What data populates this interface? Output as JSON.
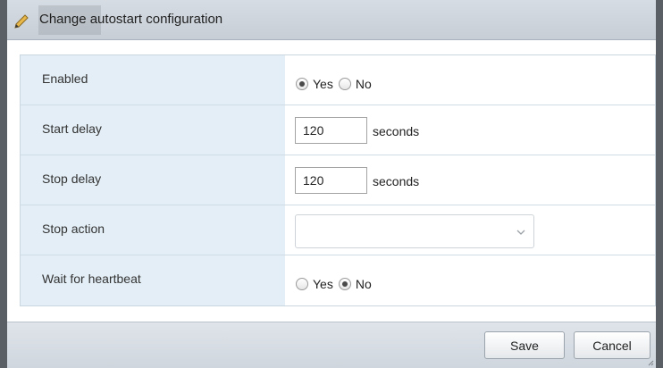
{
  "dialog": {
    "title": "Change autostart configuration",
    "icon": "pencil-icon"
  },
  "form": {
    "enabled": {
      "label": "Enabled",
      "options": [
        "Yes",
        "No"
      ],
      "selected": "Yes"
    },
    "start_delay": {
      "label": "Start delay",
      "value": "120",
      "unit": "seconds"
    },
    "stop_delay": {
      "label": "Stop delay",
      "value": "120",
      "unit": "seconds"
    },
    "stop_action": {
      "label": "Stop action",
      "selected": ""
    },
    "wait_for_heartbeat": {
      "label": "Wait for heartbeat",
      "options": [
        "Yes",
        "No"
      ],
      "selected": "No"
    }
  },
  "footer": {
    "save_label": "Save",
    "cancel_label": "Cancel"
  },
  "colors": {
    "label_column_bg": "#e3eef6",
    "titlebar_bg": "#d6dce3",
    "frame": "#5a5f66"
  }
}
